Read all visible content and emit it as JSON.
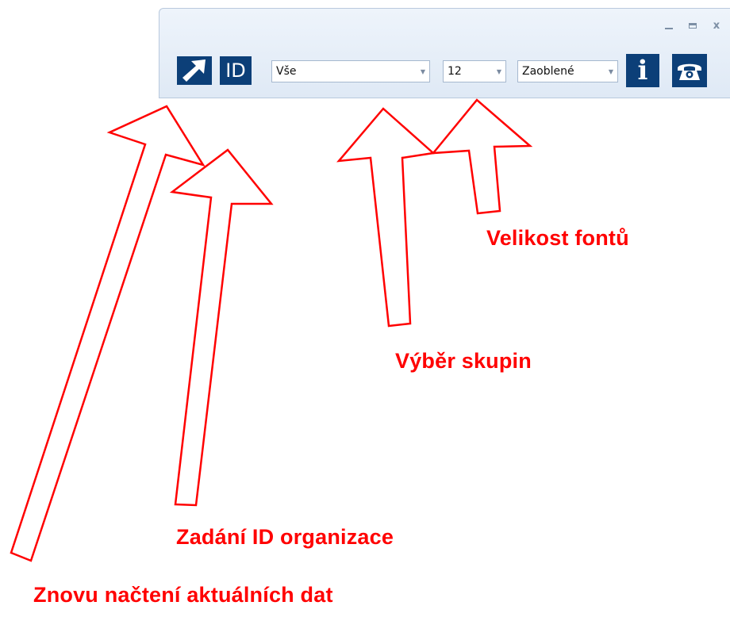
{
  "window": {
    "controls": {
      "minimize_icon": "minimize-icon",
      "maximize_icon": "maximize-icon",
      "close_icon": "close-icon",
      "close_glyph": "x"
    }
  },
  "toolbar": {
    "reload_button": {
      "icon": "diagonal-arrow-icon"
    },
    "id_button": {
      "label": "ID"
    },
    "group_select": {
      "value": "Vše"
    },
    "font_size_select": {
      "value": "12"
    },
    "style_select": {
      "value": "Zaoblené"
    },
    "info_button": {
      "label": "i"
    },
    "contact_button": {
      "icon": "telephone-icon"
    }
  },
  "annotations": {
    "font_size": "Velikost fontů",
    "group_selection": "Výběr skupin",
    "org_id": "Zadání ID organizace",
    "reload_data": "Znovu načtení aktuálních dat"
  },
  "colors": {
    "annotation": "#ff0000",
    "button_bg": "#0c3f78",
    "toolbar_bg": "#e4edf7"
  }
}
